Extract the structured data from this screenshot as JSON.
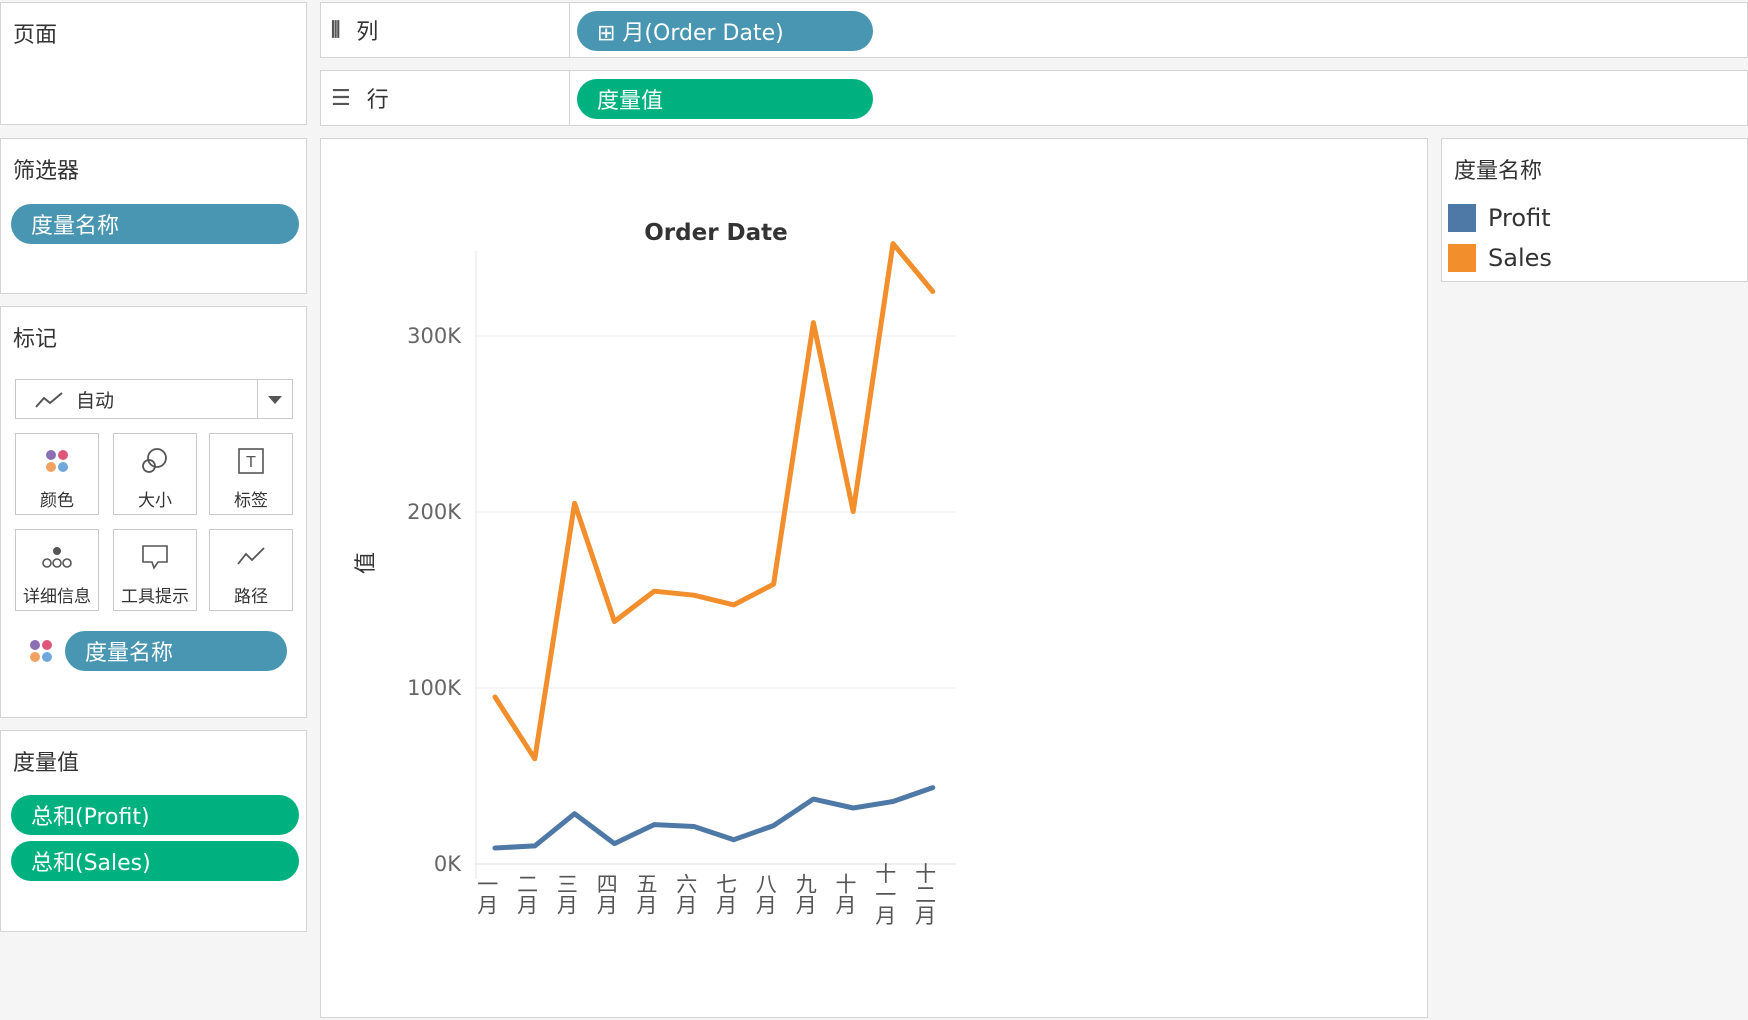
{
  "pages_panel": {
    "title": "页面"
  },
  "columns_shelf": {
    "label": "列",
    "pill": "⊞ 月(Order Date)"
  },
  "rows_shelf": {
    "label": "行",
    "pill": "度量值"
  },
  "filters_panel": {
    "title": "筛选器",
    "pill": "度量名称"
  },
  "marks_panel": {
    "title": "标记",
    "mark_type": "自动",
    "buttons": {
      "color": "颜色",
      "size": "大小",
      "label": "标签",
      "detail": "详细信息",
      "tooltip": "工具提示",
      "path": "路径"
    },
    "color_pill": "度量名称"
  },
  "measure_values_panel": {
    "title": "度量值",
    "pills": [
      "总和(Profit)",
      "总和(Sales)"
    ]
  },
  "legend": {
    "title": "度量名称",
    "items": [
      {
        "label": "Profit",
        "color": "#4e79a7"
      },
      {
        "label": "Sales",
        "color": "#f28e2b"
      }
    ]
  },
  "chart_data": {
    "type": "line",
    "title": "Order Date",
    "xlabel": "",
    "ylabel": "值",
    "categories": [
      "一月",
      "二月",
      "三月",
      "四月",
      "五月",
      "六月",
      "七月",
      "八月",
      "九月",
      "十月",
      "十一月",
      "十二月"
    ],
    "y_ticks": [
      "0K",
      "100K",
      "200K",
      "300K"
    ],
    "ylim": [
      0,
      370000
    ],
    "grid": true,
    "series": [
      {
        "name": "Sales",
        "color": "#f28e2b",
        "values": [
          94900,
          59800,
          205000,
          137800,
          155000,
          152700,
          147200,
          159000,
          307600,
          200300,
          352500,
          325300
        ]
      },
      {
        "name": "Profit",
        "color": "#4e79a7",
        "values": [
          9100,
          10300,
          28600,
          11600,
          22400,
          21300,
          13800,
          21800,
          36900,
          31800,
          35500,
          43400
        ]
      }
    ]
  }
}
